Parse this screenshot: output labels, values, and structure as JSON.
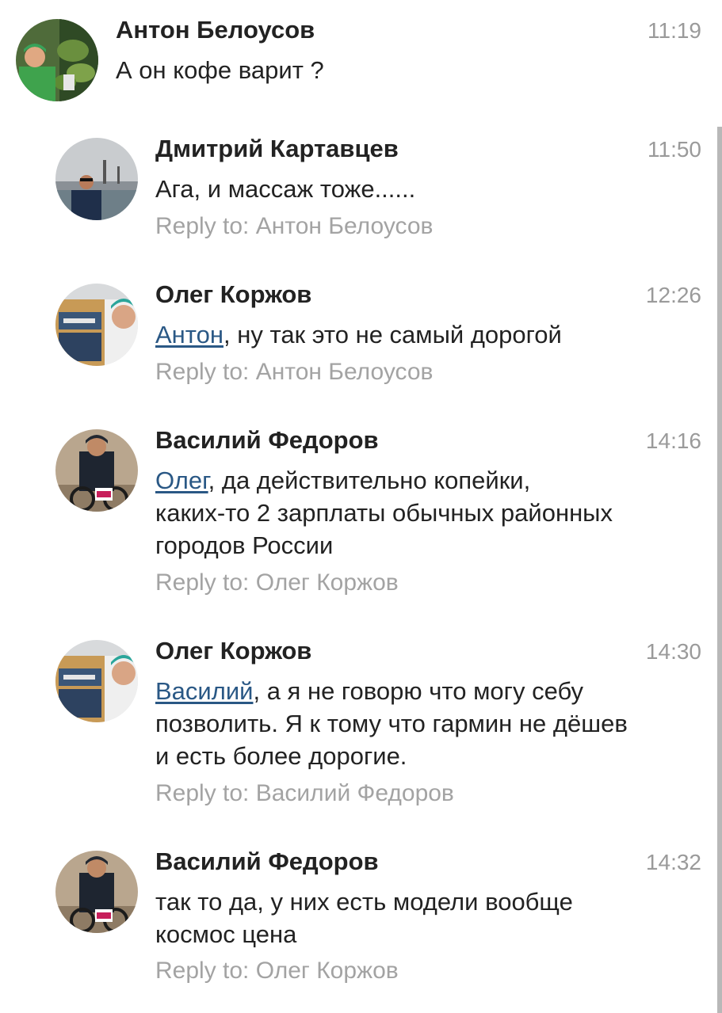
{
  "comments": [
    {
      "author": "Антон Белоусов",
      "time": "11:19",
      "text": "А он кофе варит ?",
      "reply_prefix": "",
      "reply_name": ""
    },
    {
      "author": "Дмитрий Картавцев",
      "time": "11:50",
      "text": "Ага, и массаж тоже......",
      "reply_prefix": "Reply to:",
      "reply_name": "Антон Белоусов"
    },
    {
      "author": "Олег Коржов",
      "time": "12:26",
      "mention": "Антон",
      "text": ", ну так это не самый дорогой",
      "reply_prefix": "Reply to:",
      "reply_name": "Антон Белоусов"
    },
    {
      "author": "Василий Федоров",
      "time": "14:16",
      "mention": "Олег",
      "text": ", да действительно копейки,",
      "text_line2": "каких-то 2 зарплаты обычных районных",
      "text_line3": "городов России",
      "reply_prefix": "Reply to:",
      "reply_name": "Олег Коржов"
    },
    {
      "author": "Олег Коржов",
      "time": "14:30",
      "mention": "Василий",
      "text": ", а я не говорю что могу себу",
      "text_line2": "позволить. Я к тому что гармин не дёшев",
      "text_line3": "и есть более дорогие.",
      "reply_prefix": "Reply to:",
      "reply_name": "Василий Федоров"
    },
    {
      "author": "Василий Федоров",
      "time": "14:32",
      "text": "так то да, у них есть модели вообще",
      "text_line2": "космос цена",
      "reply_prefix": "Reply to:",
      "reply_name": "Олег Коржов"
    }
  ],
  "colors": {
    "mention": "#2a5885",
    "meta": "#9a9a9a",
    "text": "#222222",
    "scrollbar": "#b8b8b8"
  }
}
